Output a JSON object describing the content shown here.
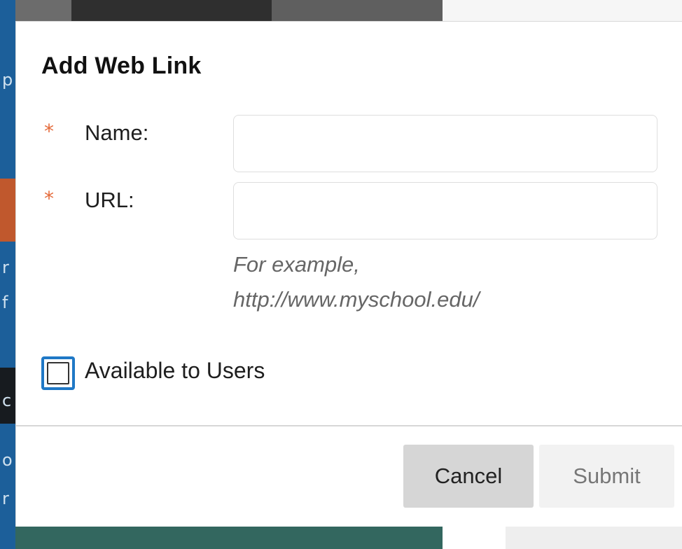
{
  "dialog": {
    "title": "Add Web Link",
    "required_marker": "*",
    "fields": {
      "name": {
        "label": "Name:",
        "value": "",
        "placeholder": ""
      },
      "url": {
        "label": "URL:",
        "value": "",
        "placeholder": ""
      }
    },
    "url_hint_line1": "For example,",
    "url_hint_line2": "http://www.myschool.edu/",
    "available_checkbox": {
      "label": "Available to Users",
      "checked": false
    },
    "buttons": {
      "cancel": "Cancel",
      "submit": "Submit"
    }
  },
  "background_fragments": {
    "left_glyphs": [
      "p",
      "r",
      "f",
      "c",
      "o",
      "r"
    ]
  },
  "colors": {
    "required": "#e46a3a",
    "focus_outline": "#1f78c6",
    "hint": "#666666",
    "cancel_bg": "#d6d6d6",
    "submit_bg": "#f2f2f2"
  }
}
